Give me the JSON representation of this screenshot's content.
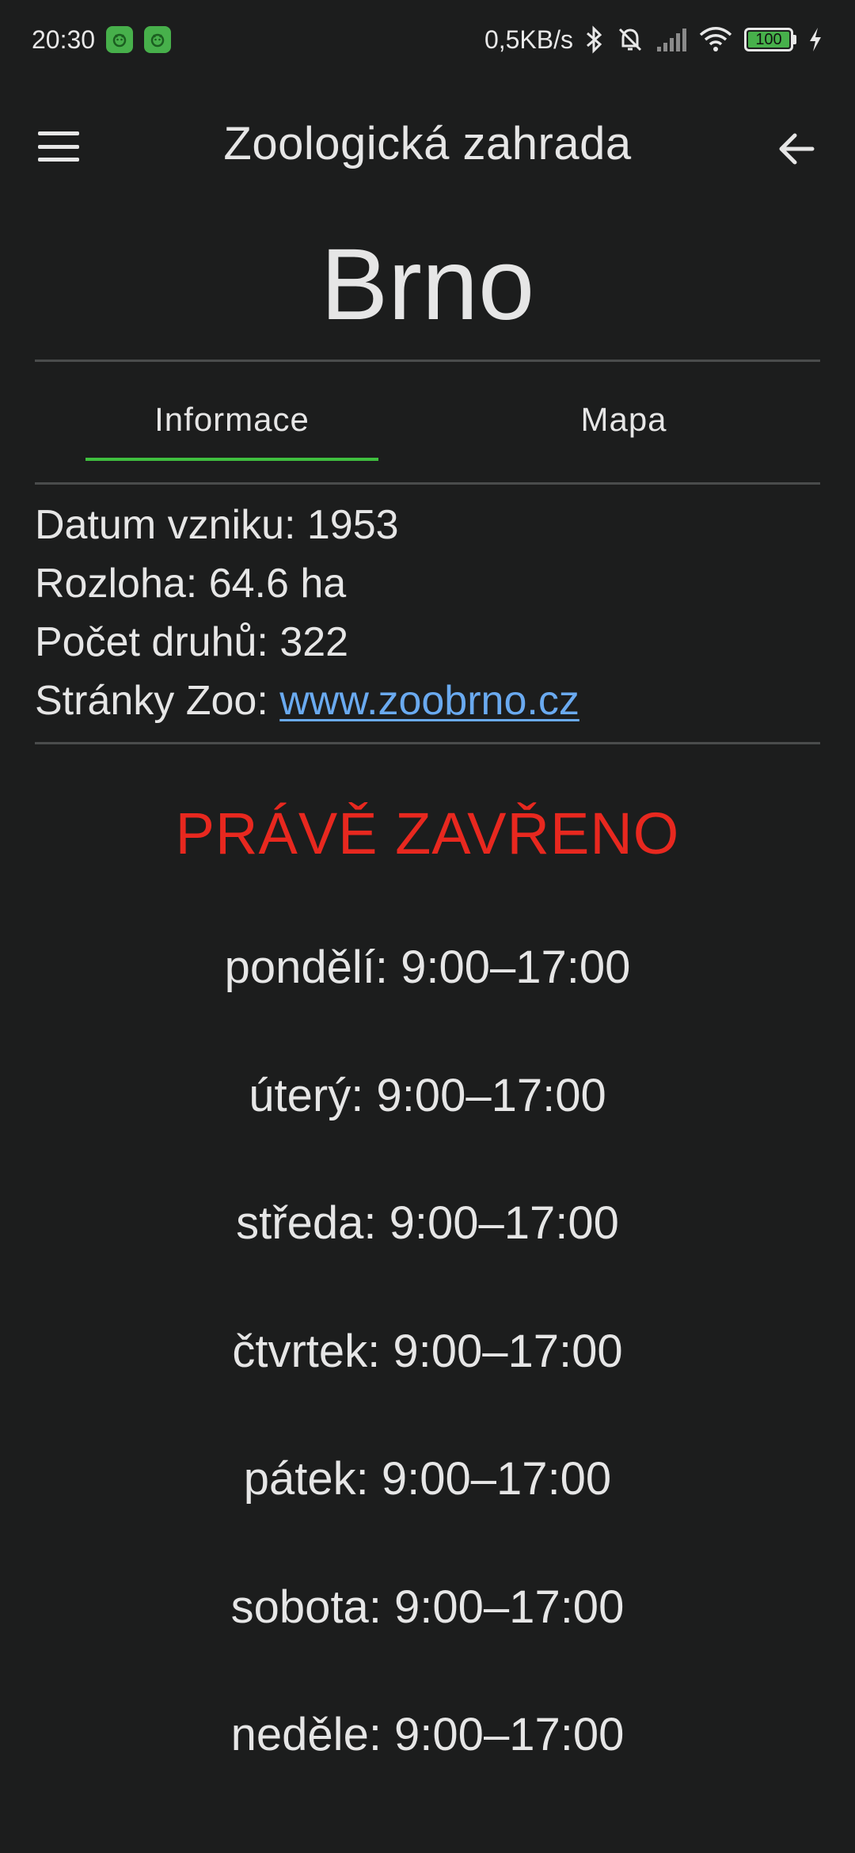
{
  "status_bar": {
    "time": "20:30",
    "network_speed": "0,5KB/s",
    "battery": "100",
    "icons": [
      "app-notification-icon",
      "app-notification-icon",
      "bluetooth-icon",
      "bell-off-icon",
      "signal-icon",
      "wifi-icon",
      "battery-icon",
      "charging-icon"
    ]
  },
  "app_bar": {
    "title": "Zoologická zahrada"
  },
  "heading": {
    "city": "Brno"
  },
  "tabs": [
    {
      "label": "Informace",
      "selected": true
    },
    {
      "label": "Mapa",
      "selected": false
    }
  ],
  "info": {
    "founded_label": "Datum vzniku: ",
    "founded_value": "1953",
    "area_label": "Rozloha: ",
    "area_value": "64.6 ha",
    "species_label": "Počet druhů: ",
    "species_value": "322",
    "website_label": "Stránky Zoo: ",
    "website_value": "www.zoobrno.cz"
  },
  "open_status": "PRÁVĚ ZAVŘENO",
  "opening_hours": [
    "pondělí: 9:00–17:00",
    "úterý: 9:00–17:00",
    "středa: 9:00–17:00",
    "čtvrtek: 9:00–17:00",
    "pátek: 9:00–17:00",
    "sobota: 9:00–17:00",
    "neděle: 9:00–17:00"
  ],
  "colors": {
    "background": "#1c1d1d",
    "text": "#e6e6e6",
    "accent_tab": "#3fbf3f",
    "link": "#6aaaf0",
    "closed": "#e8281f"
  }
}
